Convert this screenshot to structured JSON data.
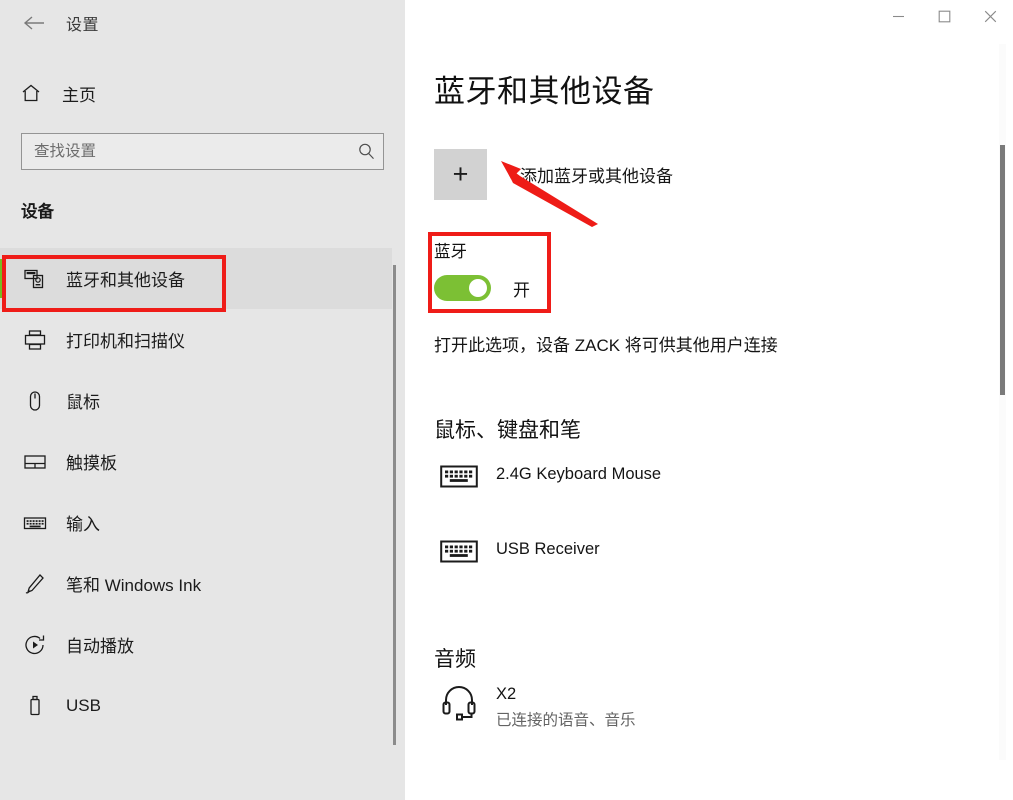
{
  "window": {
    "app_title": "设置",
    "back_icon": "back-arrow-icon",
    "minimize_label": "—",
    "maximize_label": "□",
    "close_label": "✕"
  },
  "sidebar": {
    "home": {
      "label": "主页",
      "icon": "home-icon"
    },
    "search": {
      "placeholder": "查找设置",
      "value": "",
      "icon": "search-icon"
    },
    "section_label": "设备",
    "items": [
      {
        "label": "蓝牙和其他设备",
        "icon": "bluetooth-devices-icon",
        "selected": true
      },
      {
        "label": "打印机和扫描仪",
        "icon": "printer-icon",
        "selected": false
      },
      {
        "label": "鼠标",
        "icon": "mouse-icon",
        "selected": false
      },
      {
        "label": "触摸板",
        "icon": "touchpad-icon",
        "selected": false
      },
      {
        "label": "输入",
        "icon": "keyboard-icon",
        "selected": false
      },
      {
        "label": "笔和 Windows Ink",
        "icon": "pen-icon",
        "selected": false
      },
      {
        "label": "自动播放",
        "icon": "autoplay-icon",
        "selected": false
      },
      {
        "label": "USB",
        "icon": "usb-icon",
        "selected": false
      }
    ]
  },
  "main": {
    "page_title": "蓝牙和其他设备",
    "add_device": {
      "label": "添加蓝牙或其他设备",
      "icon": "plus-icon"
    },
    "bluetooth": {
      "name": "蓝牙",
      "state_label": "开",
      "is_on": true,
      "description": "打开此选项，设备 ZACK 将可供其他用户连接"
    },
    "groups": [
      {
        "title": "鼠标、键盘和笔",
        "devices": [
          {
            "name": "2.4G Keyboard Mouse",
            "status": "",
            "icon": "keyboard-icon"
          },
          {
            "name": "USB Receiver",
            "status": "",
            "icon": "keyboard-icon"
          }
        ]
      },
      {
        "title": "音频",
        "devices": [
          {
            "name": "X2",
            "status": "已连接的语音、音乐",
            "icon": "headset-icon"
          }
        ]
      }
    ]
  },
  "annotations": {
    "highlight_color": "#ef1c18",
    "accent_color": "#76bc21",
    "toggle_on_color": "#7cc034",
    "boxes": [
      "sidebar-bluetooth-item",
      "bluetooth-toggle-block"
    ],
    "arrow": "points-to-add-device-button"
  }
}
